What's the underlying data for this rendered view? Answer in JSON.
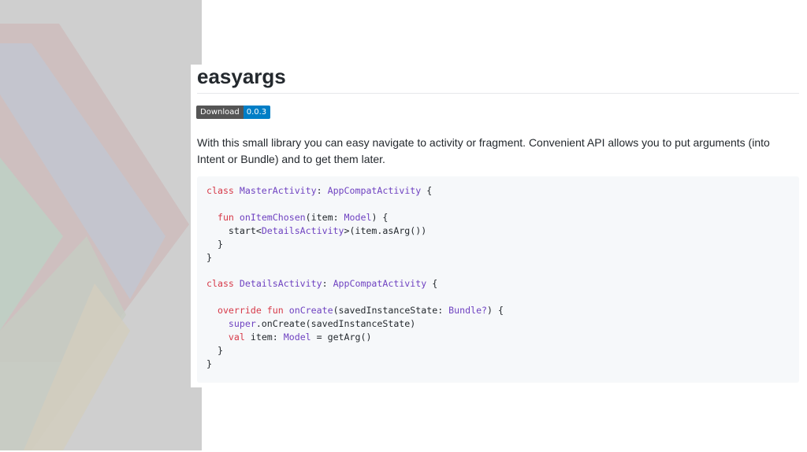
{
  "readme": {
    "title": "easyargs",
    "badge": {
      "label": "Download",
      "version": "0.0.3"
    },
    "description": "With this small library you can easy navigate to activity or fragment. Convenient API allows you to put arguments (into Intent or Bundle) and to get them later."
  },
  "code": {
    "t_class": "class",
    "t_fun": "fun",
    "t_override": "override",
    "t_super": "super",
    "t_val": "val",
    "t_master": "MasterActivity",
    "t_appcompat": "AppCompatActivity",
    "t_details": "DetailsActivity",
    "t_model": "Model",
    "t_bundle": "Bundle?",
    "t_onItemChosen": "onItemChosen",
    "t_onCreate": "onCreate",
    "t_colon": ": ",
    "t_open_brace": " {",
    "t_item_param": "(item: ",
    "t_paren_brace": ") {",
    "t_start": "start<",
    "t_start_args": ">(item.asArg())",
    "t_saved_param": "(savedInstanceState: ",
    "t_super_call": ".onCreate(savedInstanceState)",
    "t_item_decl": " item: ",
    "t_getarg": " = getArg()",
    "t_close": "}",
    "t_indent1": "  ",
    "t_indent2": "    ",
    "t_space": " "
  },
  "colors": {
    "side_panel": "#cfcfcf",
    "badge_left": "#555555",
    "badge_right": "#007ec6",
    "keyword": "#d73a49",
    "type": "#6f42c1",
    "code_bg": "#f6f8fa"
  }
}
